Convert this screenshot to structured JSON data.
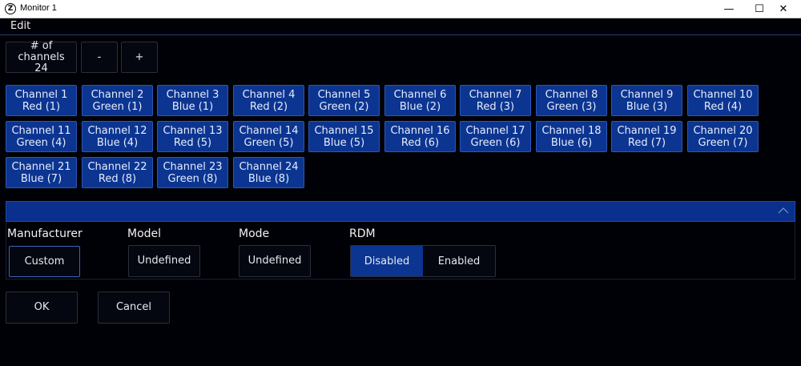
{
  "window": {
    "title": "Monitor 1",
    "icon_glyph": "Z",
    "minimize": "—",
    "maximize": "☐",
    "close": "✕"
  },
  "menu": {
    "edit": "Edit"
  },
  "channel_count": {
    "label_line1": "# of channels",
    "value": "24",
    "decrement": "-",
    "increment": "+"
  },
  "channels": [
    {
      "name": "Channel 1",
      "color": "Red (1)"
    },
    {
      "name": "Channel 2",
      "color": "Green (1)"
    },
    {
      "name": "Channel 3",
      "color": "Blue (1)"
    },
    {
      "name": "Channel 4",
      "color": "Red (2)"
    },
    {
      "name": "Channel 5",
      "color": "Green (2)"
    },
    {
      "name": "Channel 6",
      "color": "Blue (2)"
    },
    {
      "name": "Channel 7",
      "color": "Red (3)"
    },
    {
      "name": "Channel 8",
      "color": "Green (3)"
    },
    {
      "name": "Channel 9",
      "color": "Blue (3)"
    },
    {
      "name": "Channel 10",
      "color": "Red (4)"
    },
    {
      "name": "Channel 11",
      "color": "Green (4)"
    },
    {
      "name": "Channel 12",
      "color": "Blue (4)"
    },
    {
      "name": "Channel 13",
      "color": "Red (5)"
    },
    {
      "name": "Channel 14",
      "color": "Green (5)"
    },
    {
      "name": "Channel 15",
      "color": "Blue (5)"
    },
    {
      "name": "Channel 16",
      "color": "Red (6)"
    },
    {
      "name": "Channel 17",
      "color": "Green (6)"
    },
    {
      "name": "Channel 18",
      "color": "Blue (6)"
    },
    {
      "name": "Channel 19",
      "color": "Red (7)"
    },
    {
      "name": "Channel 20",
      "color": "Green (7)"
    },
    {
      "name": "Channel 21",
      "color": "Blue (7)"
    },
    {
      "name": "Channel 22",
      "color": "Red (8)"
    },
    {
      "name": "Channel 23",
      "color": "Green (8)"
    },
    {
      "name": "Channel 24",
      "color": "Blue (8)"
    }
  ],
  "properties": {
    "manufacturer": {
      "label": "Manufacturer",
      "value": "Custom"
    },
    "model": {
      "label": "Model",
      "value": "Undefined"
    },
    "mode": {
      "label": "Mode",
      "value": "Undefined"
    },
    "rdm": {
      "label": "RDM",
      "options": [
        "Disabled",
        "Enabled"
      ],
      "selected": "Disabled"
    }
  },
  "actions": {
    "ok": "OK",
    "cancel": "Cancel"
  },
  "colors": {
    "background": "#000106",
    "accent": "#0c3591",
    "channel_border": "#2c57b4",
    "panel_header": "#0a2f8c"
  }
}
